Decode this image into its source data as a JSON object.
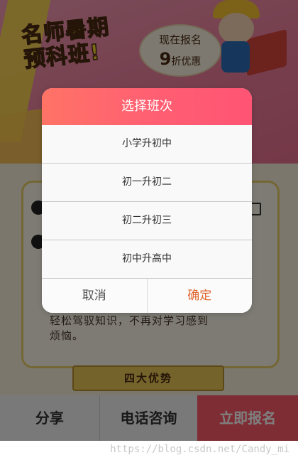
{
  "banner": {
    "promo_title_line1": "名师暑期",
    "promo_title_line2": "预科班!",
    "bubble_line1": "现在报名",
    "bubble_discount_number": "9",
    "bubble_discount_suffix": "折优惠"
  },
  "content": {
    "paragraph_line1": "轻松驾驭知识，不再对学习感到",
    "paragraph_line2": "烦恼。",
    "section_title": "四大优势"
  },
  "bottom_bar": {
    "share_label": "分享",
    "call_label": "电话咨询",
    "signup_label": "立即报名"
  },
  "dialog": {
    "title": "选择班次",
    "options": [
      {
        "label": "小学升初中"
      },
      {
        "label": "初一升初二"
      },
      {
        "label": "初二升初三"
      },
      {
        "label": "初中升高中"
      }
    ],
    "cancel_label": "取消",
    "confirm_label": "确定"
  },
  "watermark": "https://blog.csdn.net/Candy_mi",
  "colors": {
    "dialog_header_start": "#ff7366",
    "dialog_header_end": "#ff5474",
    "confirm_text": "#e0632c",
    "signup_bg": "#ff5b6a"
  }
}
